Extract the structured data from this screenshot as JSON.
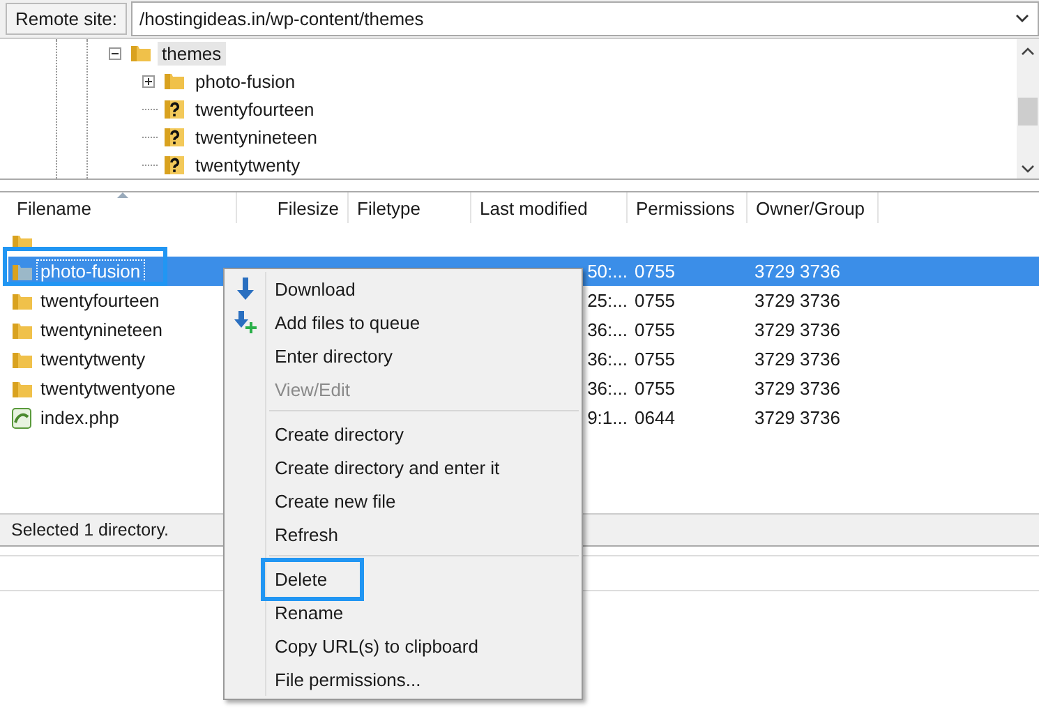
{
  "remote_site": {
    "label": "Remote site:",
    "path": "/hostingideas.in/wp-content/themes"
  },
  "tree": [
    {
      "label": "themes",
      "kind": "folder",
      "expanded": true,
      "selected": true,
      "children": [
        {
          "label": "photo-fusion",
          "kind": "folder",
          "expanded": false,
          "selected": false
        },
        {
          "label": "twentyfourteen",
          "kind": "unknown",
          "selected": false
        },
        {
          "label": "twentynineteen",
          "kind": "unknown",
          "selected": false
        },
        {
          "label": "twentytwenty",
          "kind": "unknown",
          "selected": false
        }
      ]
    }
  ],
  "file_list": {
    "columns": [
      {
        "label": "Filename",
        "sorted": true
      },
      {
        "label": "Filesize",
        "sorted": false
      },
      {
        "label": "Filetype",
        "sorted": false
      },
      {
        "label": "Last modified",
        "sorted": false
      },
      {
        "label": "Permissions",
        "sorted": false
      },
      {
        "label": "Owner/Group",
        "sorted": false
      }
    ],
    "rows": [
      {
        "kind": "parent",
        "name": "",
        "last_modified": "",
        "permissions": "",
        "owner_group": "",
        "selected": false,
        "annotated": false
      },
      {
        "kind": "folder",
        "name": "photo-fusion",
        "last_modified": "50:...",
        "permissions": "0755",
        "owner_group": "3729 3736",
        "selected": true,
        "annotated": true
      },
      {
        "kind": "folder",
        "name": "twentyfourteen",
        "last_modified": "25:...",
        "permissions": "0755",
        "owner_group": "3729 3736",
        "selected": false,
        "annotated": false
      },
      {
        "kind": "folder",
        "name": "twentynineteen",
        "last_modified": "36:...",
        "permissions": "0755",
        "owner_group": "3729 3736",
        "selected": false,
        "annotated": false
      },
      {
        "kind": "folder",
        "name": "twentytwenty",
        "last_modified": "36:...",
        "permissions": "0755",
        "owner_group": "3729 3736",
        "selected": false,
        "annotated": false
      },
      {
        "kind": "folder",
        "name": "twentytwentyone",
        "last_modified": "36:...",
        "permissions": "0755",
        "owner_group": "3729 3736",
        "selected": false,
        "annotated": false
      },
      {
        "kind": "php",
        "name": "index.php",
        "last_modified": "9:1...",
        "permissions": "0644",
        "owner_group": "3729 3736",
        "selected": false,
        "annotated": false
      }
    ]
  },
  "status_bar": "Selected 1 directory.",
  "context_menu": [
    {
      "kind": "download",
      "label": "Download",
      "disabled": false,
      "annotated": false
    },
    {
      "kind": "queue",
      "label": "Add files to queue",
      "disabled": false,
      "annotated": false
    },
    {
      "kind": "item",
      "label": "Enter directory",
      "disabled": false,
      "annotated": false
    },
    {
      "kind": "item",
      "label": "View/Edit",
      "disabled": true,
      "annotated": false
    },
    {
      "kind": "separator"
    },
    {
      "kind": "item",
      "label": "Create directory",
      "disabled": false,
      "annotated": false
    },
    {
      "kind": "item",
      "label": "Create directory and enter it",
      "disabled": false,
      "annotated": false
    },
    {
      "kind": "item",
      "label": "Create new file",
      "disabled": false,
      "annotated": false
    },
    {
      "kind": "item",
      "label": "Refresh",
      "disabled": false,
      "annotated": false
    },
    {
      "kind": "separator"
    },
    {
      "kind": "item",
      "label": "Delete",
      "disabled": false,
      "annotated": true
    },
    {
      "kind": "item",
      "label": "Rename",
      "disabled": false,
      "annotated": false
    },
    {
      "kind": "item",
      "label": "Copy URL(s) to clipboard",
      "disabled": false,
      "annotated": false
    },
    {
      "kind": "item",
      "label": "File permissions...",
      "disabled": false,
      "annotated": false
    }
  ]
}
